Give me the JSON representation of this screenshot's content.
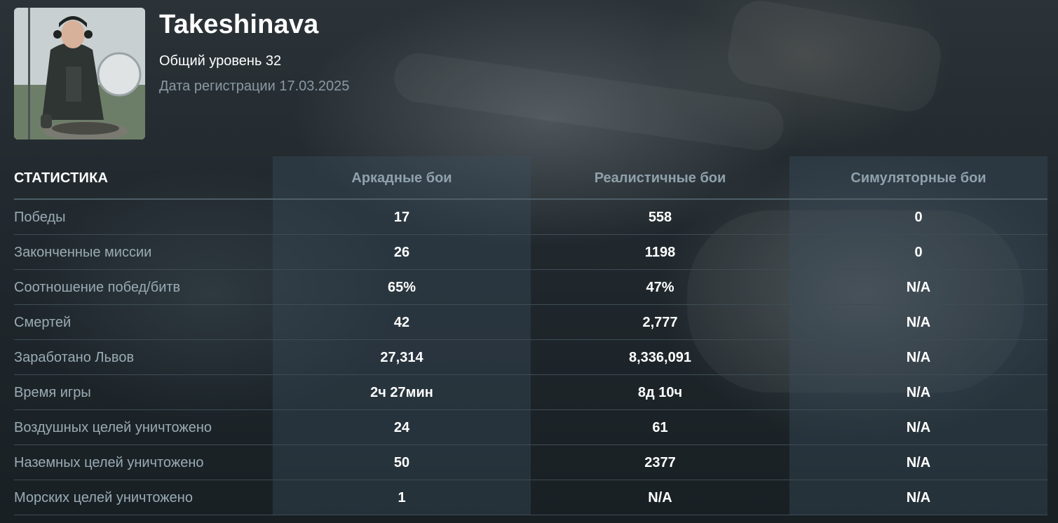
{
  "profile": {
    "name": "Takeshinava",
    "level": "Общий уровень 32",
    "registration": "Дата регистрации 17.03.2025"
  },
  "stats": {
    "title": "СТАТИСТИКА",
    "columns": [
      "Аркадные бои",
      "Реалистичные бои",
      "Симуляторные бои"
    ],
    "rows": [
      {
        "label": "Победы",
        "values": [
          "17",
          "558",
          "0"
        ]
      },
      {
        "label": "Законченные миссии",
        "values": [
          "26",
          "1198",
          "0"
        ]
      },
      {
        "label": "Соотношение побед/битв",
        "values": [
          "65%",
          "47%",
          "N/A"
        ]
      },
      {
        "label": "Смертей",
        "values": [
          "42",
          "2,777",
          "N/A"
        ]
      },
      {
        "label": "Заработано Львов",
        "values": [
          "27,314",
          "8,336,091",
          "N/A"
        ]
      },
      {
        "label": "Время игры",
        "values": [
          "2ч 27мин",
          "8д 10ч",
          "N/A"
        ]
      },
      {
        "label": "Воздушных целей уничтожено",
        "values": [
          "24",
          "61",
          "N/A"
        ]
      },
      {
        "label": "Наземных целей уничтожено",
        "values": [
          "50",
          "2377",
          "N/A"
        ]
      },
      {
        "label": "Морских целей уничтожено",
        "values": [
          "1",
          "N/A",
          "N/A"
        ]
      }
    ]
  },
  "colors": {
    "label": "#9aabb4",
    "header_mode": "#8fa1ab",
    "value": "#ffffff",
    "muted_text": "#8a99a2"
  }
}
